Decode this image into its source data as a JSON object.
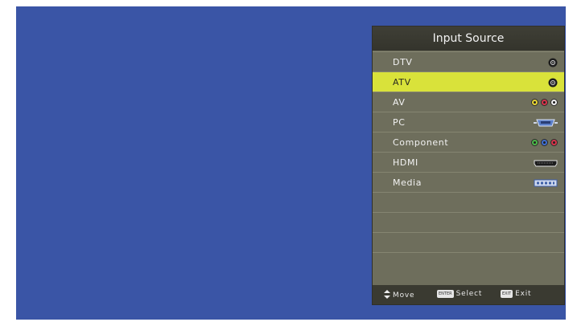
{
  "menu": {
    "title": "Input Source",
    "items": [
      {
        "label": "DTV",
        "icon": "coax-connector-icon",
        "selected": false
      },
      {
        "label": "ATV",
        "icon": "coax-connector-icon",
        "selected": true
      },
      {
        "label": "AV",
        "icon": "rca-composite-icon",
        "selected": false
      },
      {
        "label": "PC",
        "icon": "vga-connector-icon",
        "selected": false
      },
      {
        "label": "Component",
        "icon": "rca-component-icon",
        "selected": false
      },
      {
        "label": "HDMI",
        "icon": "hdmi-connector-icon",
        "selected": false
      },
      {
        "label": "Media",
        "icon": "usb-connector-icon",
        "selected": false
      }
    ]
  },
  "footer": {
    "move_label": "Move",
    "enter_key": "ENTER",
    "select_label": "Select",
    "exit_key": "EXIT",
    "exit_label": "Exit"
  },
  "colors": {
    "background": "#3a55a6",
    "panel": "#6e6e5c",
    "highlight": "#d9e23a",
    "title_bar": "#3a3a31"
  }
}
